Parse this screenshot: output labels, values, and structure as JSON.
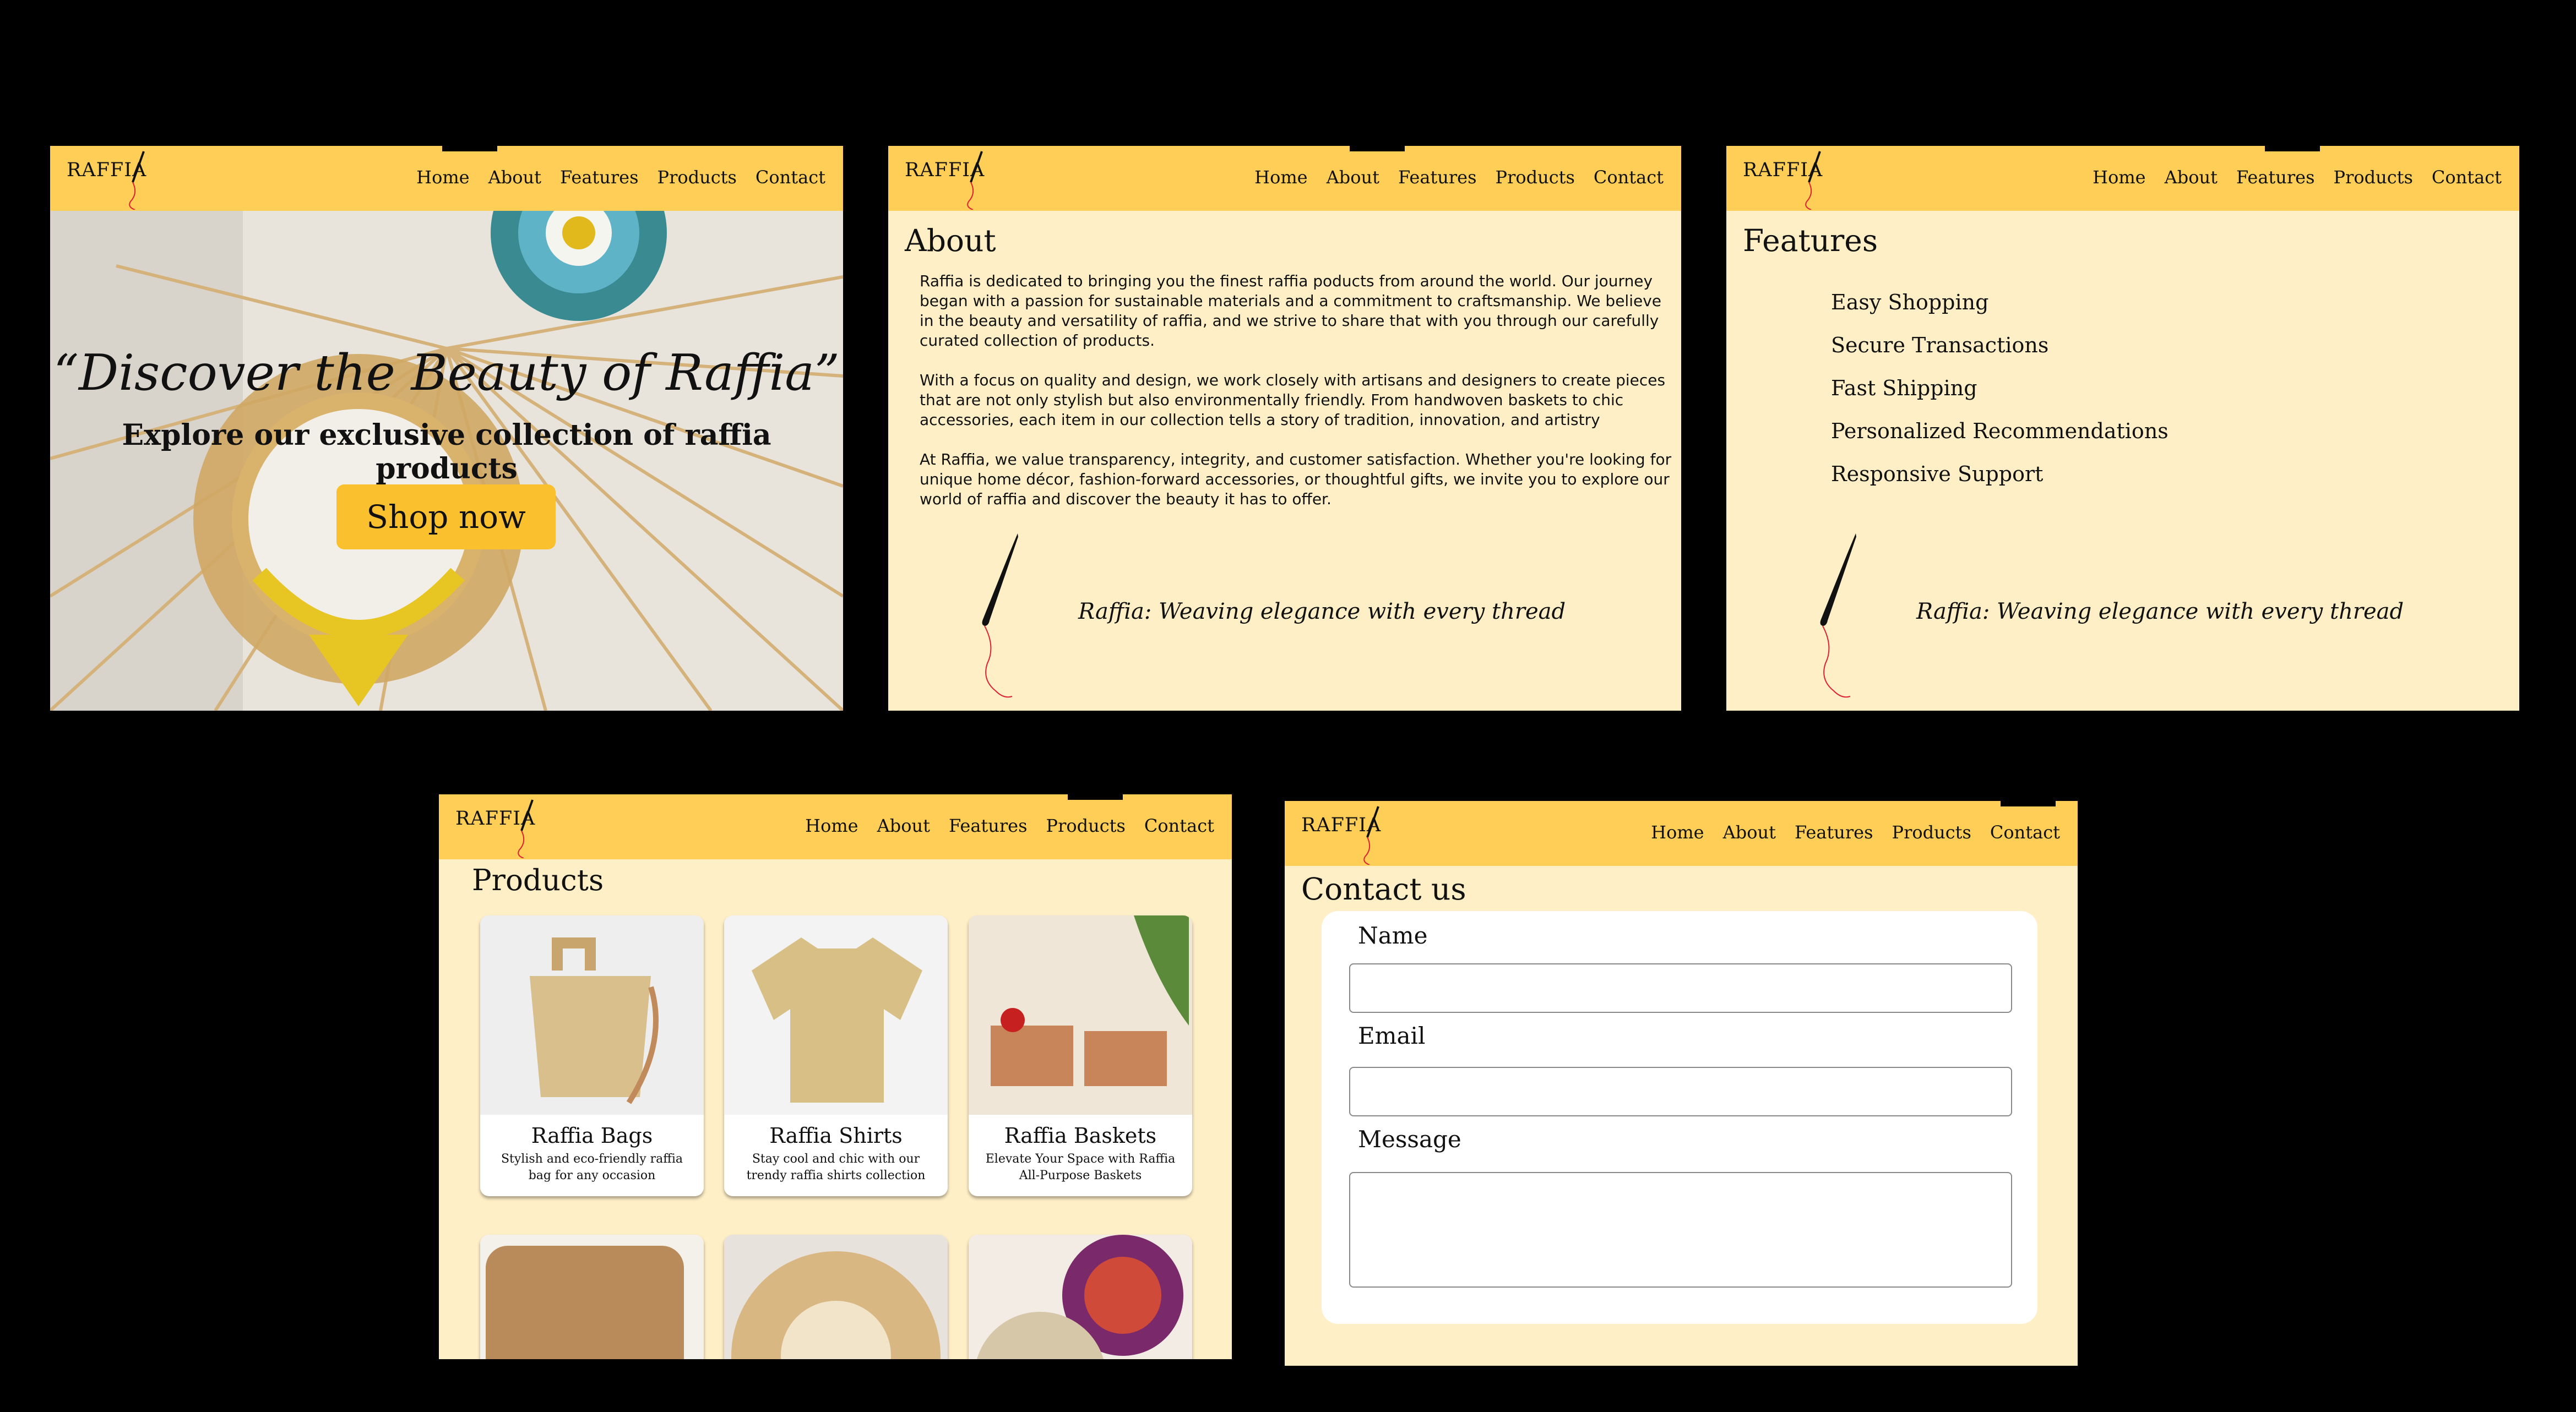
{
  "brand": "RAFFIA",
  "nav": [
    "Home",
    "About",
    "Features",
    "Products",
    "Contact"
  ],
  "home": {
    "quote": "“Discover the Beauty of Raffia”",
    "subtitle": "Explore our exclusive collection of raffia products",
    "cta": "Shop now"
  },
  "about": {
    "title": "About",
    "paragraphs": [
      "Raffia is dedicated to bringing you the finest raffia poducts from around the world. Our journey began with a passion for sustainable materials and a commitment to craftsmanship. We believe in the beauty and versatility of raffia, and we strive to share that with you through our carefully curated collection of products.",
      "With a focus on quality and design, we work closely with artisans and designers to create pieces that are not only stylish but also environmentally friendly. From handwoven baskets to chic accessories, each item in our collection tells a story of tradition, innovation, and artistry",
      "At Raffia, we value transparency, integrity, and customer satisfaction. Whether you're looking for unique home décor, fashion-forward accessories, or thoughtful gifts, we invite you to explore our world of raffia and discover the beauty it has to offer."
    ],
    "tagline": "Raffia: Weaving elegance with every thread"
  },
  "features": {
    "title": "Features",
    "items": [
      "Easy Shopping",
      "Secure Transactions",
      "Fast Shipping",
      "Personalized Recommendations",
      "Responsive Support"
    ],
    "tagline": "Raffia: Weaving elegance with every thread"
  },
  "products": {
    "title": "Products",
    "items": [
      {
        "name": "Raffia Bags",
        "desc": "Stylish and eco-friendly raffia bag for any occasion"
      },
      {
        "name": "Raffia Shirts",
        "desc": "Stay cool and chic with our trendy raffia shirts collection"
      },
      {
        "name": "Raffia Baskets",
        "desc": "Elevate Your Space with Raffia All-Purpose Baskets"
      }
    ]
  },
  "contact": {
    "title": "Contact us",
    "name_label": "Name",
    "email_label": "Email",
    "message_label": "Message"
  },
  "colors": {
    "header": "#FECE56",
    "page": "#FFEFC7",
    "button": "#FBC02D"
  }
}
